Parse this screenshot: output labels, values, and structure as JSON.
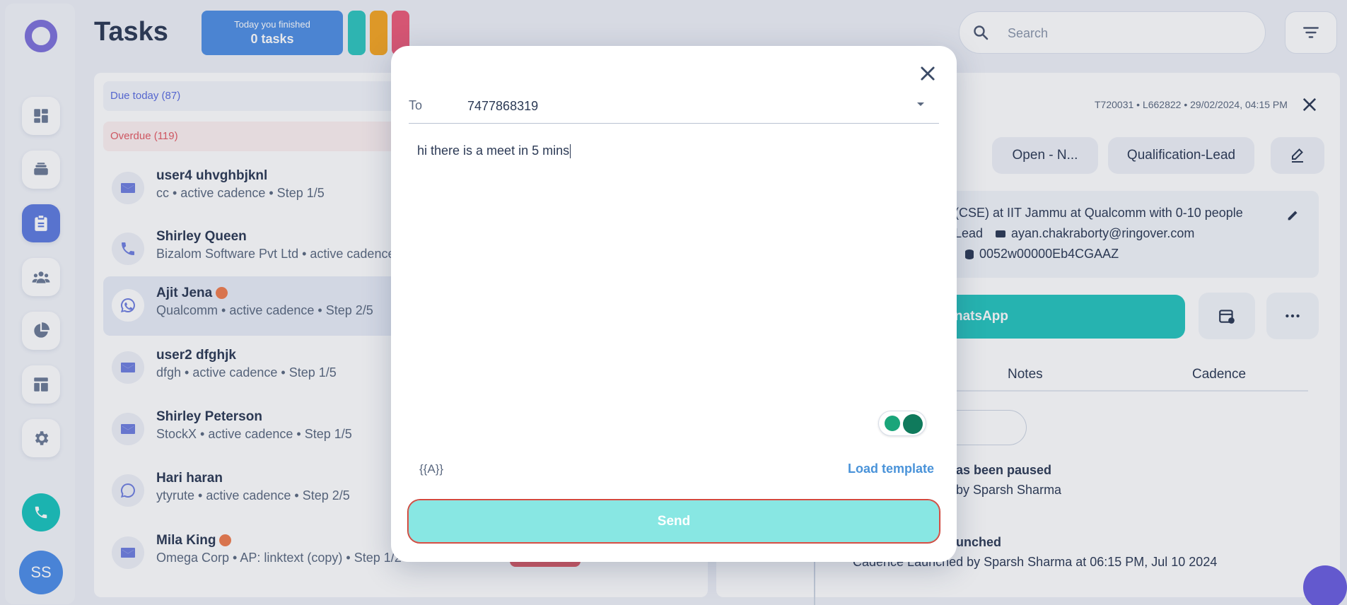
{
  "app": {
    "title": "Tasks",
    "logo": "ringover-cadence-logo",
    "nav_icons": [
      "dashboard-icon",
      "inbox-stack-icon",
      "clipboard-tasks-icon",
      "people-icon",
      "pie-chart-icon",
      "layout-icon",
      "settings-gear-icon"
    ],
    "active_nav": "clipboard-tasks-icon",
    "avatar_initials": "SS",
    "colors": {
      "accent": "#5e7be0",
      "teal": "#19c4bd",
      "overdue": "#e45b64",
      "send_bg": "#88e7e3"
    }
  },
  "header": {
    "finished_line1": "Today you finished",
    "finished_line2": "0 tasks",
    "search_placeholder": "Search"
  },
  "task_list": {
    "tabs": [
      {
        "label": "Due today (87)"
      },
      {
        "label": "Overdue (119)"
      }
    ],
    "items": [
      {
        "name": "user4 uhvghbjknl",
        "sub": "cc • active cadence • Step 1/5",
        "type": "mail-icon"
      },
      {
        "name": "Shirley Queen",
        "sub": "Bizalom Software Pvt Ltd • active cadence",
        "type": "phone-icon"
      },
      {
        "name": "Ajit Jena",
        "sub": "Qualcomm • active cadence • Step 2/5",
        "type": "whatsapp-icon"
      },
      {
        "name": "user2 dfghjk",
        "sub": "dfgh • active cadence • Step 1/5",
        "type": "mail-icon"
      },
      {
        "name": "Shirley Peterson",
        "sub": "StockX • active cadence • Step 1/5",
        "type": "mail-icon"
      },
      {
        "name": "Hari haran",
        "sub": "ytyrute • active cadence • Step 2/5",
        "type": "whatsapp-icon"
      },
      {
        "name": "Mila King",
        "sub": "Omega Corp • AP: linktext (copy) • Step 1/2",
        "type": "mail-icon"
      }
    ]
  },
  "detail": {
    "meta": "T720031 • L662822 • 29/02/2024, 04:15 PM",
    "chips": [
      "Open - N...",
      "Qualification-Lead"
    ],
    "info_line1": "(CSE) at IIT Jammu at Qualcomm with 0-10 people",
    "info_lead": "Lead",
    "info_email": "ayan.chakraborty@ringover.com",
    "info_id": "0052w00000Eb4CGAAZ",
    "whatsapp_label": "natsApp",
    "tabs": [
      "Notes",
      "Cadence"
    ],
    "activities": [
      {
        "title": "as been paused",
        "sub": "by Sparsh Sharma"
      },
      {
        "title": "unched",
        "sub": "Cadence Launched by Sparsh Sharma at 06:15 PM, Jul 10 2024"
      }
    ]
  },
  "modal": {
    "to_label": "To",
    "to_value": "7477868319",
    "message": "hi there is a meet in 5 mins",
    "variable_token": "{{A}}",
    "load_template_label": "Load template",
    "send_label": "Send"
  }
}
